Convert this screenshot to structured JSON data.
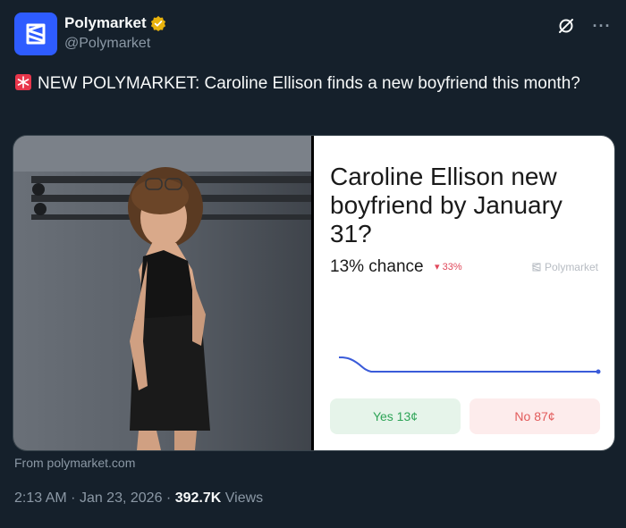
{
  "author": {
    "display_name": "Polymarket",
    "handle": "@Polymarket",
    "brand_color": "#2e5cff",
    "verified_color": "#e8b20c"
  },
  "icons": {
    "avatar": "polymarket-logo-icon",
    "verified": "verified-badge-icon",
    "grok": "grok-icon",
    "more": "more-icon",
    "siren": "siren-emoji-icon"
  },
  "tweet": {
    "text": "NEW POLYMARKET: Caroline Ellison finds a new boyfriend this month?"
  },
  "card": {
    "question": "Caroline Ellison new boyfriend by January 31?",
    "chance": "13% chance",
    "delta": "▾ 33%",
    "brand": "Polymarket",
    "yes_label": "Yes 13¢",
    "no_label": "No 87¢",
    "accent_line": "#3a5bd9"
  },
  "source": "From polymarket.com",
  "meta": {
    "time": "2:13 AM",
    "date": "Jan 23, 2026",
    "views_count": "392.7K",
    "views_label": "Views"
  },
  "more_glyph": "···"
}
